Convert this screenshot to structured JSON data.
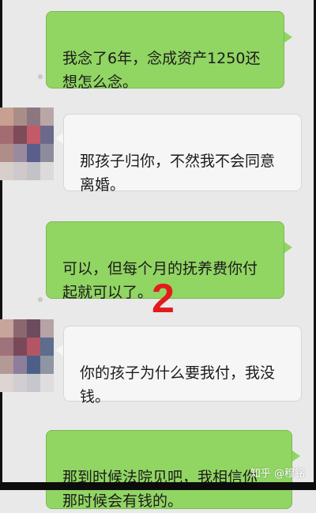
{
  "chat": {
    "messages": [
      {
        "side": "me",
        "text": "我念了6年，念成资产1250还\n想怎么念。"
      },
      {
        "side": "other",
        "text": "那孩子归你，不然我不会同意\n离婚。"
      },
      {
        "side": "me",
        "text": "可以，但每个月的抚养费你付\n起就可以了。"
      },
      {
        "side": "other",
        "text": "你的孩子为什么要我付，我没\n钱。"
      },
      {
        "side": "me",
        "text": "那到时候法院见吧，我相信你\n那时候会有钱的。"
      }
    ]
  },
  "overlay": {
    "number": "2"
  },
  "watermark": {
    "platform": "知乎",
    "author": "@穆铭"
  },
  "colors": {
    "my_bubble": "#91d563",
    "their_bubble": "#f6f6f6",
    "background": "#e9e9e9",
    "overlay_number": "#e31b1b"
  },
  "icons": {
    "avatar": "avatar-pixelated"
  }
}
